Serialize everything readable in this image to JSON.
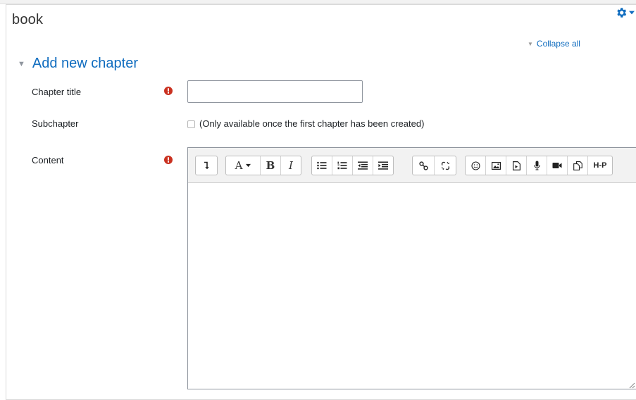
{
  "page": {
    "title": "book"
  },
  "actions": {
    "collapse_all": "Collapse all"
  },
  "section": {
    "title": "Add new chapter"
  },
  "fields": {
    "chapter_title": {
      "label": "Chapter title",
      "value": "",
      "placeholder": ""
    },
    "subchapter": {
      "label": "Subchapter",
      "checked": false,
      "note": "(Only available once the first chapter has been created)"
    },
    "content": {
      "label": "Content",
      "value": ""
    }
  },
  "editor": {
    "toolbar_groups": [
      [
        "show-more-buttons"
      ],
      [
        "font-color",
        "bold",
        "italic"
      ],
      [
        "unordered-list",
        "ordered-list",
        "outdent",
        "indent"
      ],
      [
        "link",
        "unlink"
      ],
      [
        "emoji",
        "image",
        "media",
        "record-audio",
        "record-video",
        "manage-files",
        "h5p"
      ]
    ],
    "labels": {
      "text_color": "A",
      "bold": "B",
      "italic": "I",
      "h5p": "H-P"
    }
  },
  "colors": {
    "link": "#0f6cbf",
    "required": "#ca3120",
    "border": "#8f959e",
    "toolbar_bg": "#f2f2f2"
  }
}
